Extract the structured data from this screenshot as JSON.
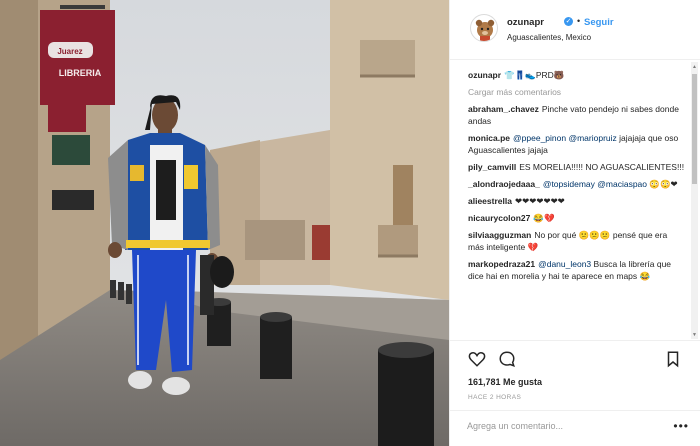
{
  "photo": {
    "sign_brand": "Juarez",
    "sign_text": "LIBRERIA"
  },
  "post": {
    "username": "ozunapr",
    "follow_label": "Seguir",
    "location": "Aguascalientes, Mexico",
    "verified_icon": "verified-badge-icon",
    "caption_user": "ozunapr",
    "caption_text": "👕👖👟PRD🐻"
  },
  "load_more": "Cargar más comentarios",
  "comments": [
    {
      "user": "abraham_.chavez",
      "mention": "",
      "text": "Pinche vato pendejo ni sabes donde andas"
    },
    {
      "user": "monica.pe",
      "mention": "@ppee_pinon @mariopruiz",
      "text": "jajajaja que oso Aguascalientes jajaja"
    },
    {
      "user": "pily_camvill",
      "mention": "",
      "text": "ES MORELIA!!!!! NO AGUASCALIENTES!!!"
    },
    {
      "user": "_alondraojedaaa_",
      "mention": "@topsidemay @maciaspao",
      "text": "😳😳❤"
    },
    {
      "user": "alieestrella",
      "mention": "",
      "text": "❤❤❤❤❤❤❤"
    },
    {
      "user": "nicaurycolon27",
      "mention": "",
      "text": "😂💔"
    },
    {
      "user": "silviaagguzman",
      "mention": "",
      "text": "No por qué 😕😕😕 pensé que era más inteligente 💔"
    },
    {
      "user": "markopedraza21",
      "mention": "@danu_leon3",
      "text": "Busca la librería que dice hai en morelia y hai te aparece en maps 😂"
    }
  ],
  "actions": {
    "like_icon": "heart-icon",
    "comment_icon": "comment-icon",
    "save_icon": "bookmark-icon"
  },
  "likes": "161,781 Me gusta",
  "time_ago": "HACE 2 HORAS",
  "comment_box": {
    "placeholder": "Agrega un comentario...",
    "more_icon": "more-options-icon"
  }
}
